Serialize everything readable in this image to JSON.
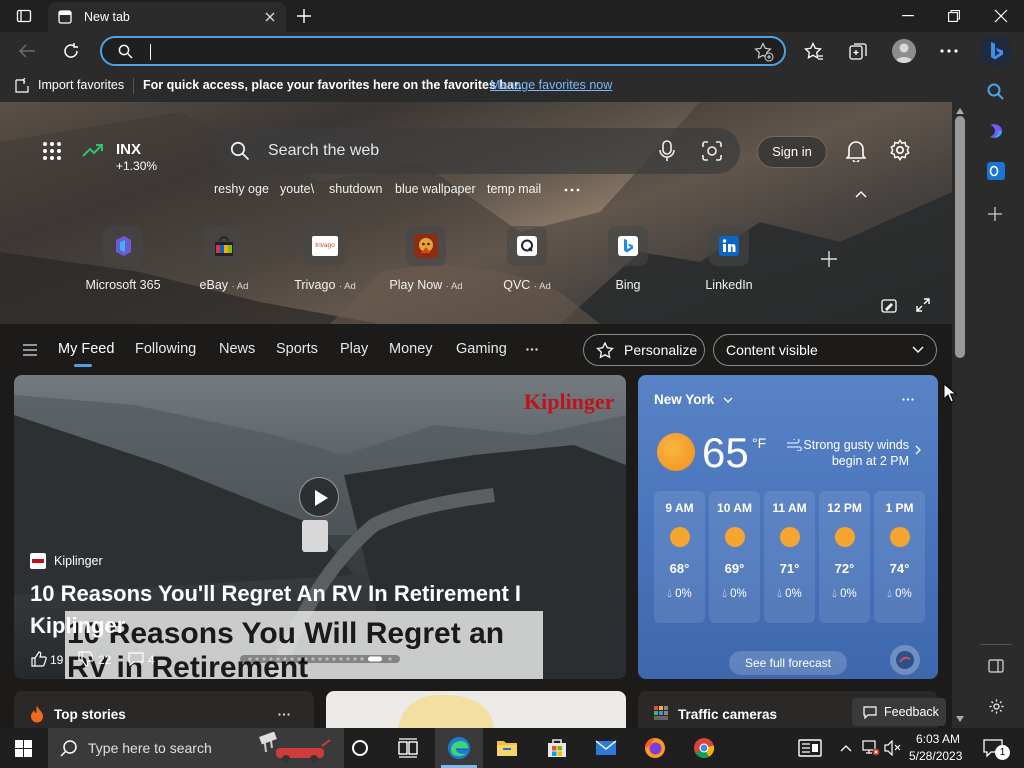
{
  "window": {
    "tab_title": "New tab"
  },
  "favorites_bar": {
    "import_label": "Import favorites",
    "hint": "For quick access, place your favorites here on the favorites bar.",
    "manage_link": "Manage favorites now"
  },
  "hero": {
    "ticker": {
      "symbol": "INX",
      "change": "+1.30%"
    },
    "search_placeholder": "Search the web",
    "sign_in": "Sign in",
    "trending": [
      "reshy oge",
      "youte\\",
      "shutdown",
      "blue wallpaper",
      "temp mail"
    ],
    "quick_links": [
      {
        "label": "Microsoft 365",
        "ad": ""
      },
      {
        "label": "eBay",
        "ad": "· Ad"
      },
      {
        "label": "Trivago",
        "ad": "· Ad"
      },
      {
        "label": "Play Now",
        "ad": "· Ad"
      },
      {
        "label": "QVC",
        "ad": "· Ad"
      },
      {
        "label": "Bing",
        "ad": ""
      },
      {
        "label": "LinkedIn",
        "ad": ""
      }
    ],
    "trivago_logo": "trivago"
  },
  "feed_nav": {
    "tabs": [
      "My Feed",
      "Following",
      "News",
      "Sports",
      "Play",
      "Money",
      "Gaming"
    ],
    "personalize": "Personalize",
    "content_visible": "Content visible"
  },
  "main_story": {
    "brand_logo": "Kiplinger",
    "source": "Kiplinger",
    "title": "10 Reasons You'll Regret An RV In Retirement I Kiplinger",
    "overlay_text": "10 Reasons You Will Regret an RV in Retirement",
    "likes": "19",
    "dislikes": "22",
    "comments": "4"
  },
  "weather": {
    "location": "New York",
    "temp": "65",
    "unit": "°F",
    "alert": "Strong gusty winds begin at 2 PM",
    "hours": [
      {
        "time": "9 AM",
        "temp": "68°",
        "precip": "0%"
      },
      {
        "time": "10 AM",
        "temp": "69°",
        "precip": "0%"
      },
      {
        "time": "11 AM",
        "temp": "71°",
        "precip": "0%"
      },
      {
        "time": "12 PM",
        "temp": "72°",
        "precip": "0%"
      },
      {
        "time": "1 PM",
        "temp": "74°",
        "precip": "0%"
      }
    ],
    "forecast_button": "See full forecast"
  },
  "bottom": {
    "top_stories": "Top stories",
    "traffic": "Traffic cameras",
    "feedback": "Feedback"
  },
  "taskbar": {
    "search_placeholder": "Type here to search",
    "time": "6:03 AM",
    "date": "5/28/2023",
    "notification_count": "1"
  },
  "colors": {
    "accent": "#4ca3e3",
    "link": "#79b8ff",
    "weather_card": "#4a76bd",
    "sun": "#f6a531"
  }
}
